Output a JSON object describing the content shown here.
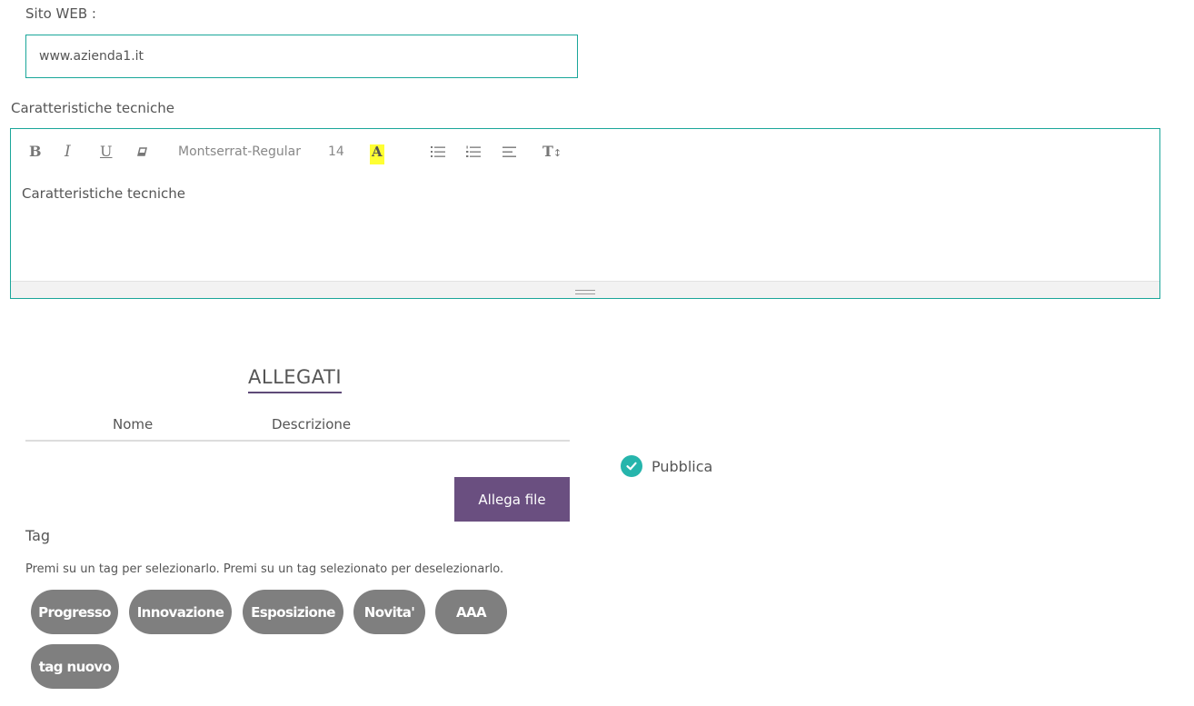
{
  "website": {
    "label": "Sito WEB :",
    "value": "www.azienda1.it"
  },
  "specs": {
    "label": "Caratteristiche tecniche",
    "content": "Caratteristiche tecniche",
    "toolbar": {
      "bold": "B",
      "italic": "I",
      "underline": "U",
      "font": "Montserrat-Regular",
      "size": "14",
      "highlight": "A",
      "line_height": "T",
      "icons": [
        "bold-icon",
        "italic-icon",
        "underline-icon",
        "eraser-icon",
        "highlight-icon",
        "unordered-list-icon",
        "ordered-list-icon",
        "align-icon",
        "line-height-icon"
      ]
    }
  },
  "attachments": {
    "title": "ALLEGATI",
    "columns": [
      "Nome",
      "Descrizione"
    ],
    "rows": [],
    "button_label": "Allega file"
  },
  "publish": {
    "label": "Pubblica",
    "checked": true,
    "check_color": "#26b5ac"
  },
  "tags": {
    "label": "Tag",
    "help": "Premi su un tag per selezionarlo. Premi su un tag selezionato per deselezionarlo.",
    "items": [
      "Progresso",
      "Innovazione",
      "Esposizione",
      "Novita'",
      "AAA",
      "tag nuovo"
    ]
  },
  "colors": {
    "accent_border": "#1aa69a",
    "primary_button": "#6a4f80",
    "tag_bg": "#7f7f7f",
    "highlight": "#ffff33"
  }
}
